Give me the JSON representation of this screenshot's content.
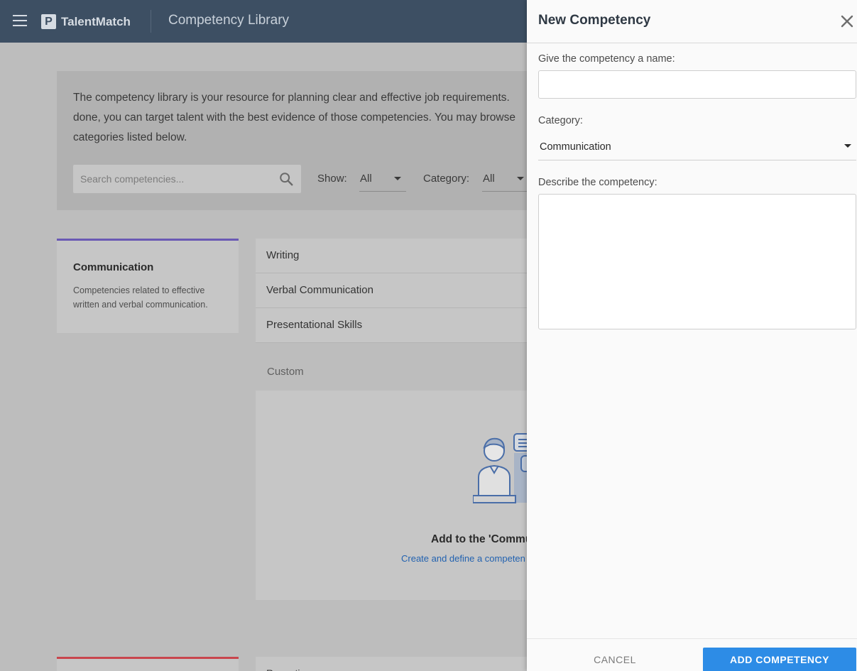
{
  "app": {
    "brand": "TalentMatch",
    "logo_letter": "P",
    "page_title": "Competency Library"
  },
  "info": {
    "text": "The competency library is your resource for planning clear and effective job requirements.\ndone, you can target talent with the best evidence of those competencies. You may browse\ncategories listed below.",
    "search_placeholder": "Search competencies...",
    "show_label": "Show:",
    "show_value": "All",
    "category_label": "Category:",
    "category_value": "All"
  },
  "category": {
    "title": "Communication",
    "description": "Competencies related to effective written and verbal communication."
  },
  "competencies": [
    {
      "label": "Writing"
    },
    {
      "label": "Verbal Communication"
    },
    {
      "label": "Presentational Skills"
    }
  ],
  "custom": {
    "section_label": "Custom",
    "title": "Add to the 'Commu",
    "link": "Create and define a competen"
  },
  "next_item": {
    "label": "Receptive"
  },
  "drawer": {
    "title": "New Competency",
    "name_label": "Give the competency a name:",
    "name_value": "",
    "category_label": "Category:",
    "category_value": "Communication",
    "description_label": "Describe the competency:",
    "description_value": "",
    "cancel_label": "CANCEL",
    "add_label": "ADD COMPETENCY"
  },
  "colors": {
    "topbar": "#3d4f63",
    "accent_blue": "#2d8ce6",
    "communication_accent": "#6a59b4",
    "second_category_accent": "#c9464d",
    "link": "#2262b0"
  }
}
